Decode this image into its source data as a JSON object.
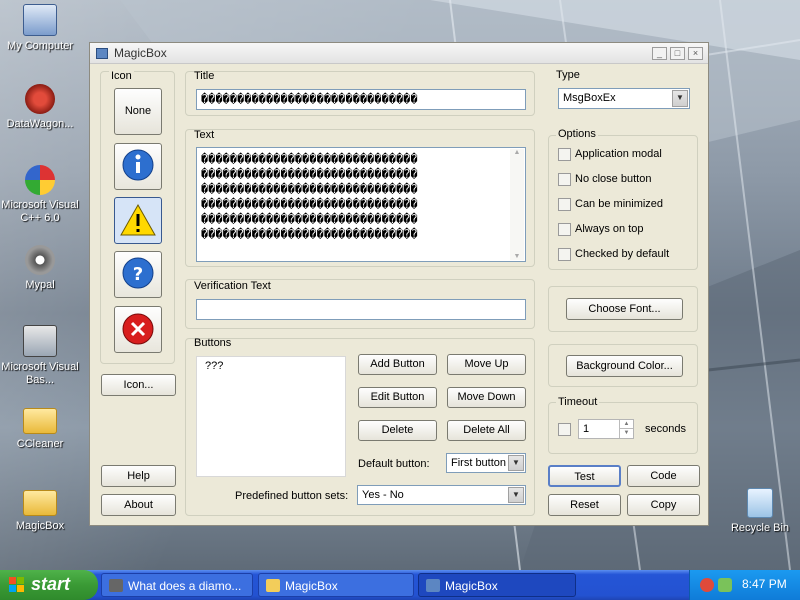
{
  "desktop": {
    "icons": [
      {
        "label": "My Computer"
      },
      {
        "label": "DataWagon..."
      },
      {
        "label": "Microsoft Visual C++ 6.0"
      },
      {
        "label": "Mypal"
      },
      {
        "label": "Microsoft Visual Bas..."
      },
      {
        "label": "CCleaner"
      },
      {
        "label": "MagicBox"
      },
      {
        "label": "Recycle Bin"
      }
    ]
  },
  "window": {
    "title": "MagicBox",
    "icon_group": {
      "label": "Icon",
      "none_label": "None",
      "icons": [
        "info-icon",
        "warning-icon",
        "question-icon",
        "error-icon"
      ],
      "selected": "warning-icon",
      "icon_button_label": "Icon..."
    },
    "title_field": {
      "label": "Title",
      "value": "������������������������������"
    },
    "text_field": {
      "label": "Text",
      "lines": [
        "������������������������������",
        "������������������������������",
        "������������������������������",
        "������������������������������",
        "������������������������������",
        "������������������������������"
      ]
    },
    "verification": {
      "label": "Verification Text",
      "value": ""
    },
    "buttons_group": {
      "label": "Buttons",
      "list_items": [
        "???"
      ],
      "add": "Add Button",
      "move_up": "Move Up",
      "edit": "Edit Button",
      "move_down": "Move Down",
      "delete": "Delete",
      "delete_all": "Delete All",
      "default_label": "Default button:",
      "default_value": "First button",
      "predefined_label": "Predefined button sets:",
      "predefined_value": "Yes - No"
    },
    "type": {
      "label": "Type",
      "value": "MsgBoxEx"
    },
    "options": {
      "label": "Options",
      "items": [
        {
          "label": "Application modal",
          "checked": false
        },
        {
          "label": "No close button",
          "checked": false
        },
        {
          "label": "Can be minimized",
          "checked": false
        },
        {
          "label": "Always on top",
          "checked": false
        },
        {
          "label": "Checked by default",
          "checked": false
        }
      ]
    },
    "choose_font": "Choose Font...",
    "background_color": "Background Color...",
    "timeout": {
      "label": "Timeout",
      "value": "1",
      "unit": "seconds",
      "enabled": false
    },
    "help": "Help",
    "about": "About",
    "test": "Test",
    "code": "Code",
    "reset": "Reset",
    "copy": "Copy"
  },
  "taskbar": {
    "start": "start",
    "tasks": [
      {
        "label": "What does a diamo...",
        "icon": "browser-icon"
      },
      {
        "label": "MagicBox",
        "icon": "folder-icon"
      },
      {
        "label": "MagicBox",
        "icon": "window-icon",
        "active": true
      }
    ],
    "clock": "8:47 PM"
  },
  "colors": {
    "taskbar": "#2352d1",
    "start": "#3a9a35",
    "window_bg": "#ece9d8",
    "selected_icon_bg": "#d6e4f7"
  }
}
